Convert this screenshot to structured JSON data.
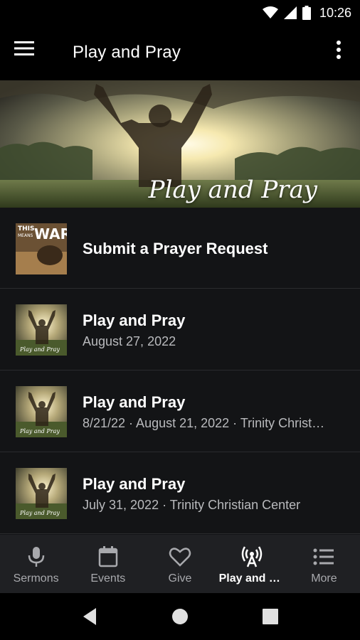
{
  "status_bar": {
    "time": "10:26"
  },
  "app_bar": {
    "title": "Play and Pray"
  },
  "hero": {
    "title_text": "Play and Pray"
  },
  "list": {
    "items": [
      {
        "title": "Submit a Prayer Request",
        "subtitle": ""
      },
      {
        "title": "Play and Pray",
        "subtitle": "August 27, 2022"
      },
      {
        "title": "Play and Pray",
        "subtitle": "8/21/22 · August 21, 2022 · Trinity Christ…"
      },
      {
        "title": "Play and Pray",
        "subtitle": "July 31, 2022 · Trinity Christian Center"
      }
    ],
    "thumb_war_text": {
      "line1": "THIS",
      "line2": "MEANS",
      "line3": "WAR"
    },
    "thumb_caption": "Play and Pray"
  },
  "bottom_nav": {
    "items": [
      {
        "label": "Sermons",
        "icon": "microphone-icon"
      },
      {
        "label": "Events",
        "icon": "calendar-icon"
      },
      {
        "label": "Give",
        "icon": "heart-icon"
      },
      {
        "label": "Play and Pr…",
        "icon": "broadcast-icon"
      },
      {
        "label": "More",
        "icon": "list-icon"
      }
    ],
    "active_index": 3
  },
  "colors": {
    "background": "#131416",
    "bar": "#000000",
    "bottom_nav": "#1f2023",
    "text_secondary": "#b9babd"
  }
}
